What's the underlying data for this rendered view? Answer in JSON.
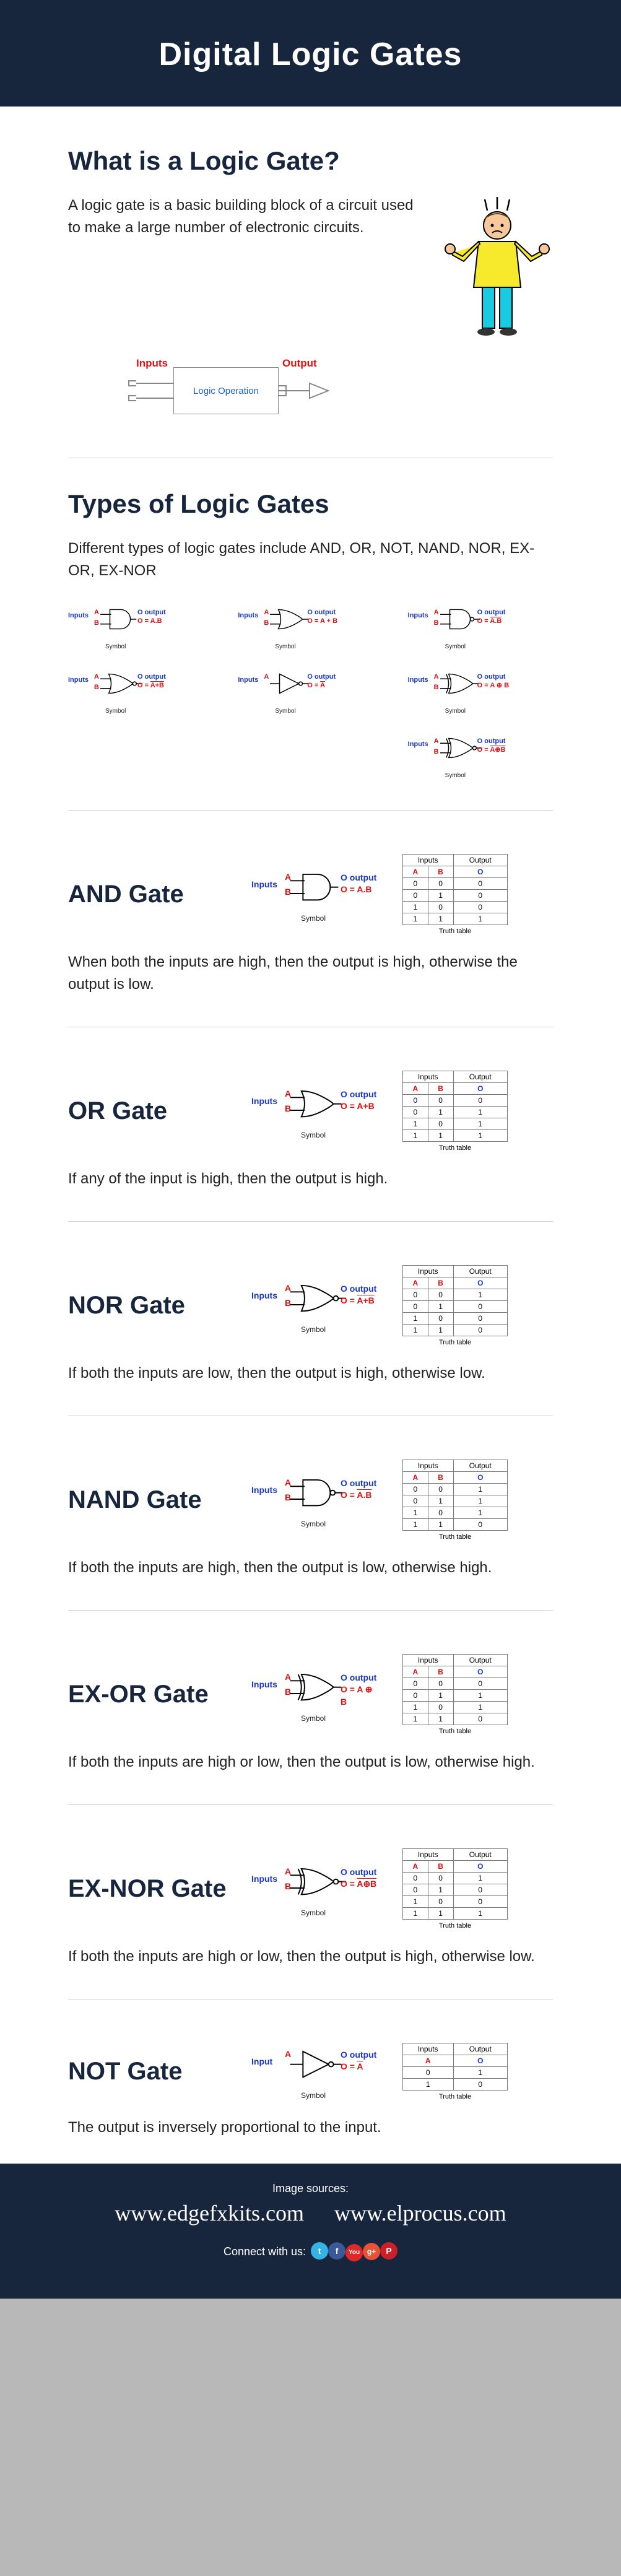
{
  "header": {
    "title": "Digital Logic Gates"
  },
  "intro": {
    "heading": "What is a Logic Gate?",
    "body": "A logic gate is a basic building block of a circuit used to make a large number of electronic circuits.",
    "diagram": {
      "inputs_label": "Inputs",
      "output_label": "Output",
      "box_text": "Logic Operation"
    }
  },
  "types": {
    "heading": "Types of Logic Gates",
    "body": "Different types of logic gates include AND, OR, NOT, NAND, NOR, EX-OR, EX-NOR",
    "symbol_caption": "Symbol",
    "mini_gates": [
      {
        "kind": "and",
        "out": "O = A.B"
      },
      {
        "kind": "or",
        "out": "O = A + B"
      },
      {
        "kind": "nand",
        "out": "O = A.B",
        "overline_out": true
      },
      {
        "kind": "nor",
        "out": "O = A+B",
        "overline_out": true
      },
      {
        "kind": "not",
        "out": "O = A",
        "overline_out": true,
        "single_input": true
      },
      {
        "kind": "xor",
        "out": "O = A ⊕ B"
      },
      {
        "kind": "xnor",
        "out": "O = A⊕B",
        "overline_out": true,
        "right_align": true
      }
    ],
    "labels": {
      "inputs": "Inputs",
      "a": "A",
      "b": "B",
      "o_line1": "O output"
    }
  },
  "gates": [
    {
      "name": "AND Gate",
      "kind": "and",
      "out_expr": "O = A.B",
      "desc": "When both the inputs are high, then the output is high, otherwise the output is low.",
      "truth": [
        [
          "0",
          "0",
          "0"
        ],
        [
          "0",
          "1",
          "0"
        ],
        [
          "1",
          "0",
          "0"
        ],
        [
          "1",
          "1",
          "1"
        ]
      ]
    },
    {
      "name": "OR Gate",
      "kind": "or",
      "out_expr": "O = A+B",
      "desc": "If  any of the input is high, then the output is high.",
      "truth": [
        [
          "0",
          "0",
          "0"
        ],
        [
          "0",
          "1",
          "1"
        ],
        [
          "1",
          "0",
          "1"
        ],
        [
          "1",
          "1",
          "1"
        ]
      ]
    },
    {
      "name": "NOR Gate",
      "kind": "nor",
      "out_expr": "O = A+B",
      "overline_out": true,
      "desc": "If both the inputs are low, then the output is high, otherwise low.",
      "truth": [
        [
          "0",
          "0",
          "1"
        ],
        [
          "0",
          "1",
          "0"
        ],
        [
          "1",
          "0",
          "0"
        ],
        [
          "1",
          "1",
          "0"
        ]
      ]
    },
    {
      "name": "NAND Gate",
      "kind": "nand",
      "out_expr": "O = A.B",
      "overline_out": true,
      "desc": "If both the inputs are high, then the output is low, otherwise high.",
      "truth": [
        [
          "0",
          "0",
          "1"
        ],
        [
          "0",
          "1",
          "1"
        ],
        [
          "1",
          "0",
          "1"
        ],
        [
          "1",
          "1",
          "0"
        ]
      ]
    },
    {
      "name": "EX-OR Gate",
      "kind": "xor",
      "out_expr": "O = A ⊕ B",
      "desc": "If both the inputs are high or low, then the output is low, otherwise high.",
      "truth": [
        [
          "0",
          "0",
          "0"
        ],
        [
          "0",
          "1",
          "1"
        ],
        [
          "1",
          "0",
          "1"
        ],
        [
          "1",
          "1",
          "0"
        ]
      ]
    },
    {
      "name": "EX-NOR Gate",
      "kind": "xnor",
      "out_expr": "O = A⊕B",
      "overline_out": true,
      "desc": "If both the inputs are high or low, then the output is high, otherwise low.",
      "truth": [
        [
          "0",
          "0",
          "1"
        ],
        [
          "0",
          "1",
          "0"
        ],
        [
          "1",
          "0",
          "0"
        ],
        [
          "1",
          "1",
          "1"
        ]
      ]
    },
    {
      "name": "NOT Gate",
      "kind": "not",
      "single_input": true,
      "out_expr": "O = A",
      "overline_out": true,
      "desc": "The output is inversely proportional to the input.",
      "truth": [
        [
          "0",
          "1"
        ],
        [
          "1",
          "0"
        ]
      ]
    }
  ],
  "gate_labels": {
    "inputs": "Inputs",
    "input": "Input",
    "a": "A",
    "b": "B",
    "o_line1": "O output",
    "symbol_caption": "Symbol",
    "tt_inputs": "Inputs",
    "tt_output": "Output",
    "tt_caption": "Truth table"
  },
  "footer": {
    "image_sources_label": "Image sources:",
    "sources": [
      "www.edgefxkits.com",
      "www.elprocus.com"
    ],
    "connect_label": "Connect with us:",
    "social": [
      {
        "name": "twitter-icon",
        "cls": "si-tw",
        "glyph": "t"
      },
      {
        "name": "facebook-icon",
        "cls": "si-fb",
        "glyph": "f"
      },
      {
        "name": "youtube-icon",
        "cls": "si-yt",
        "glyph": "You"
      },
      {
        "name": "googleplus-icon",
        "cls": "si-gp",
        "glyph": "g+"
      },
      {
        "name": "pinterest-icon",
        "cls": "si-pn",
        "glyph": "P"
      }
    ]
  }
}
